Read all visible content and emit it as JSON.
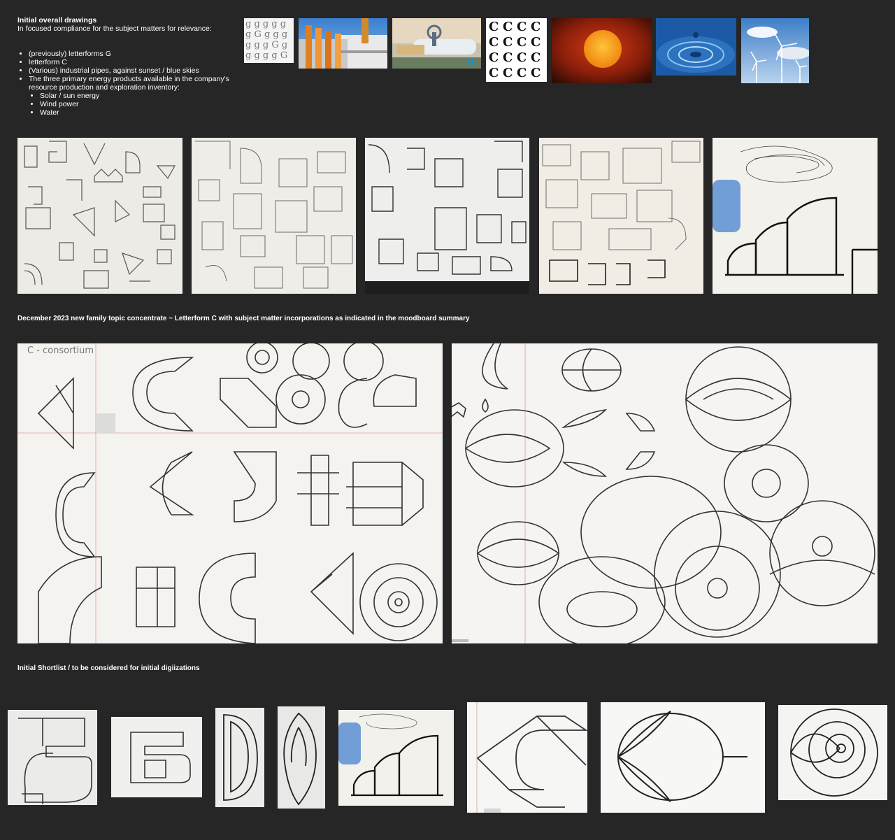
{
  "intro": {
    "title": "Initial overall drawings",
    "subtitle": "In focused compliance for the subject matters for relevance:",
    "bullets": [
      "(previously) letterforms G",
      "letterform C",
      "(Various) industrial pipes, against sunset / blue skies",
      "The three primary energy products available in the company's resource production and exploration inventory:"
    ],
    "sub_bullets": [
      "Solar / sun energy",
      "Wind power",
      "Water"
    ]
  },
  "moodboard": {
    "thumb_names": [
      "letterforms-g",
      "industrial-pipes",
      "pipes-blue-sky",
      "letterform-c",
      "sunset-sun",
      "water-drop",
      "wind-turbines"
    ]
  },
  "section2": {
    "title": "December 2023 new family topic concentrate ~ Letterform C with subject matter incorporations as indicated in the moodboard summary",
    "sketch_note": "C - consortium"
  },
  "section3": {
    "title": "Initial Shortlist / to be considered for initial digiizations"
  },
  "colors": {
    "background": "#262626",
    "paper": "#f1f0ec",
    "ink": "#2b2b2b",
    "sun_orange": "#f2a11e",
    "sky_blue": "#4a86c9"
  }
}
